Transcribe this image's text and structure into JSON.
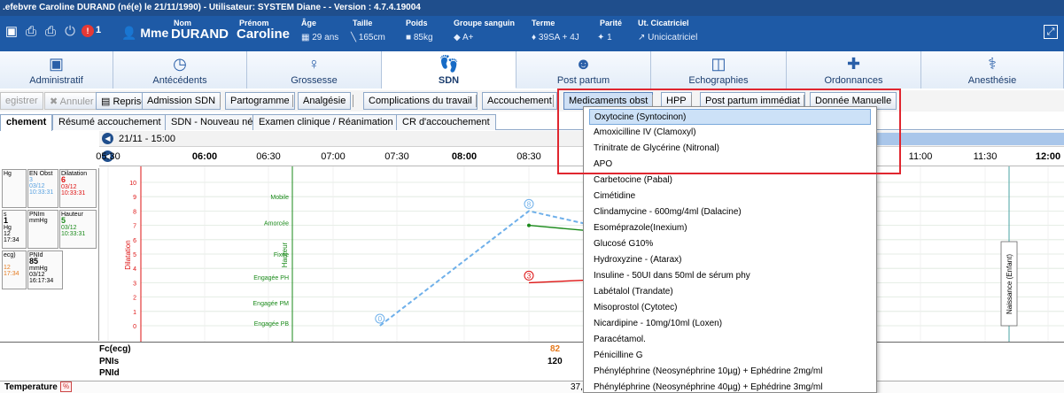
{
  "titlebar": {
    "text": ".efebvre Caroline DURAND (né(e) le 21/11/1990) - Utilisateur: SYSTEM Diane - - Version : 4.7.4.19004"
  },
  "patient": {
    "alert_count": "1",
    "civility": "Mme",
    "nom_label": "Nom",
    "nom": "DURAND",
    "prenom_label": "Prénom",
    "prenom": "Caroline",
    "age_label": "Âge",
    "age": "29 ans",
    "taille_label": "Taille",
    "taille": "165cm",
    "poids_label": "Poids",
    "poids": "85kg",
    "groupe_label": "Groupe sanguin",
    "groupe": "A+",
    "terme_label": "Terme",
    "terme": "39SA + 4J",
    "parite_label": "Parité",
    "parite": "1",
    "cicatriciel_label": "Ut. Cicatriciel",
    "cicatriciel": "Unicicatriciel"
  },
  "main_tabs": [
    {
      "label": "Administratif",
      "icon": "id-card-icon"
    },
    {
      "label": "Antécédents",
      "icon": "history-icon"
    },
    {
      "label": "Grossesse",
      "icon": "pregnancy-icon"
    },
    {
      "label": "SDN",
      "icon": "feet-icon"
    },
    {
      "label": "Post partum",
      "icon": "mother-baby-icon"
    },
    {
      "label": "Echographies",
      "icon": "ultrasound-icon"
    },
    {
      "label": "Ordonnances",
      "icon": "medical-cross-icon"
    },
    {
      "label": "Anesthésie",
      "icon": "anesthesia-icon"
    }
  ],
  "toolbar": {
    "enregistrer": "egistrer",
    "annuler": "Annuler",
    "reprise": "Reprise",
    "admission": "Admission SDN",
    "partogramme": "Partogramme",
    "analgesie": "Analgésie",
    "complications": "Complications du travail",
    "accouchement": "Accouchement",
    "medicaments": "Medicaments obst",
    "hpp": "HPP",
    "post_partum": "Post partum immédiat",
    "donnee": "Donnée Manuelle"
  },
  "subtabs": [
    "chement",
    "Résumé accouchement",
    "SDN - Nouveau né",
    "Examen clinique / Réanimation",
    "CR d'accouchement"
  ],
  "timeline": {
    "date": "21/11 - 15:00",
    "ticks": [
      "05:30",
      "06:00",
      "06:30",
      "07:00",
      "07:30",
      "08:00",
      "08:30",
      "11:00",
      "11:30",
      "12:00"
    ]
  },
  "sidecards": {
    "hg1": "Hg",
    "en_obst": "EN Obst",
    "en_obst_val": "3",
    "en_obst_date": "03/12",
    "en_obst_time": "10:33:31",
    "dilatation": "Dilatation",
    "dilatation_val": "6",
    "dilatation_date": "03/12",
    "dilatation_time": "10:33:31",
    "s_label": "s",
    "s_val": "1",
    "s_hg": "Hg",
    "s_date": "12",
    "s_time": "17:34",
    "pnim": "PNIm",
    "pnim_unit": "mmHg",
    "hauteur": "Hauteur",
    "hauteur_val": "5",
    "hauteur_date": "03/12",
    "hauteur_time": "10:33:31",
    "ecg": "ecg)",
    "ecg_a": "12",
    "ecg_b": "17:34",
    "pnid": "PNId",
    "pnid_val": "85",
    "pnid_unit": "mmHg",
    "pnid_date": "03/12",
    "pnid_time": "16:17:34"
  },
  "chart_data": {
    "type": "line",
    "y_label_left": "Dilatation",
    "y_label_right": "Hauteur",
    "y_ticks": [
      "0",
      "1",
      "2",
      "3",
      "4",
      "5",
      "6",
      "7",
      "8",
      "9",
      "10"
    ],
    "hauteur_levels": [
      "Mobile",
      "Amorcée",
      "Fixée",
      "Engagée PH",
      "Engagée PM",
      "Engagée PB"
    ],
    "series": [
      {
        "color": "#6fb0ea",
        "points": [
          [
            "07:22",
            0
          ],
          [
            "08:30",
            8
          ],
          [
            "09:00",
            7
          ]
        ],
        "point_labels": [
          "0",
          "8",
          ""
        ]
      },
      {
        "color": "#1a8a1a",
        "points": [
          [
            "08:30",
            7
          ],
          [
            "09:00",
            6.6
          ]
        ]
      },
      {
        "color": "#d11",
        "points": [
          [
            "08:30",
            3
          ],
          [
            "09:00",
            3.2
          ]
        ],
        "point_labels": [
          "3"
        ]
      }
    ],
    "event_label": "Naissance (Enfant)"
  },
  "bottom": {
    "fc_label": "Fc(ecg)",
    "fc_val": "82",
    "pnis_label": "PNIs",
    "pnis_val": "120",
    "pnid_label": "PNId",
    "temp_label": "Temperature",
    "temp_val": "37,2"
  },
  "dropdown": {
    "items": [
      "Oxytocine (Syntocinon)",
      "Amoxicilline IV (Clamoxyl)",
      "Trinitrate de Glycérine (Nitronal)",
      "APO",
      "Carbetocine (Pabal)",
      "Cimétidine",
      "Clindamycine - 600mg/4ml (Dalacine)",
      "Esoméprazole(Inexium)",
      "Glucosé G10%",
      "Hydroxyzine - (Atarax)",
      "Insuline - 50UI dans 50ml de sérum phy",
      "Labétalol (Trandate)",
      "Misoprostol (Cytotec)",
      "Nicardipine - 10mg/10ml (Loxen)",
      "Paracétamol.",
      "Pénicilline G",
      "Phényléphrine (Neosynéphrine 10µg) + Ephédrine 2mg/ml",
      "Phényléphrine (Neosynéphrine 40µg) + Ephédrine 3mg/ml"
    ]
  },
  "colors": {
    "highlight": "#e0262f",
    "header_blue": "#1e5aa6",
    "selected_item": "#cce1f7"
  }
}
